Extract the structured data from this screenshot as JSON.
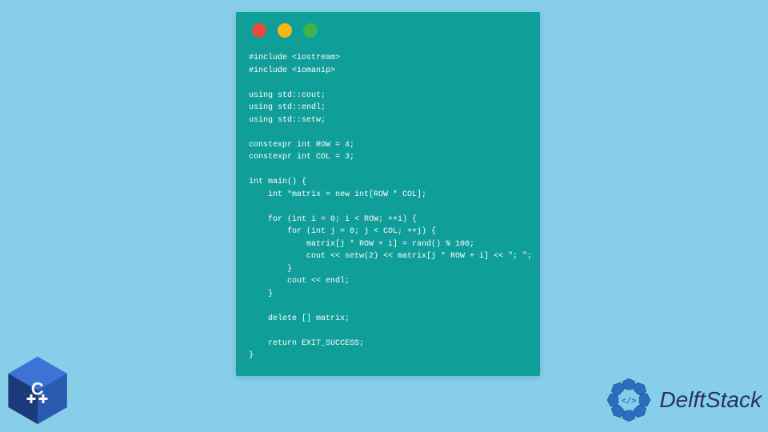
{
  "code_window": {
    "dots": [
      "red",
      "yellow",
      "green"
    ],
    "code_lines": [
      "#include <iostream>",
      "#include <iomanip>",
      "",
      "using std::cout;",
      "using std::endl;",
      "using std::setw;",
      "",
      "constexpr int ROW = 4;",
      "constexpr int COL = 3;",
      "",
      "int main() {",
      "    int *matrix = new int[ROW * COL];",
      "",
      "    for (int i = 0; i < ROW; ++i) {",
      "        for (int j = 0; j < COL; ++j) {",
      "            matrix[j * ROW + i] = rand() % 100;",
      "            cout << setw(2) << matrix[j * ROW + i] << \"; \";",
      "        }",
      "        cout << endl;",
      "    }",
      "",
      "    delete [] matrix;",
      "",
      "    return EXIT_SUCCESS;",
      "}"
    ]
  },
  "cpp_logo": {
    "label": "C",
    "plus_count": 2
  },
  "brand": {
    "name": "DelftStack"
  }
}
